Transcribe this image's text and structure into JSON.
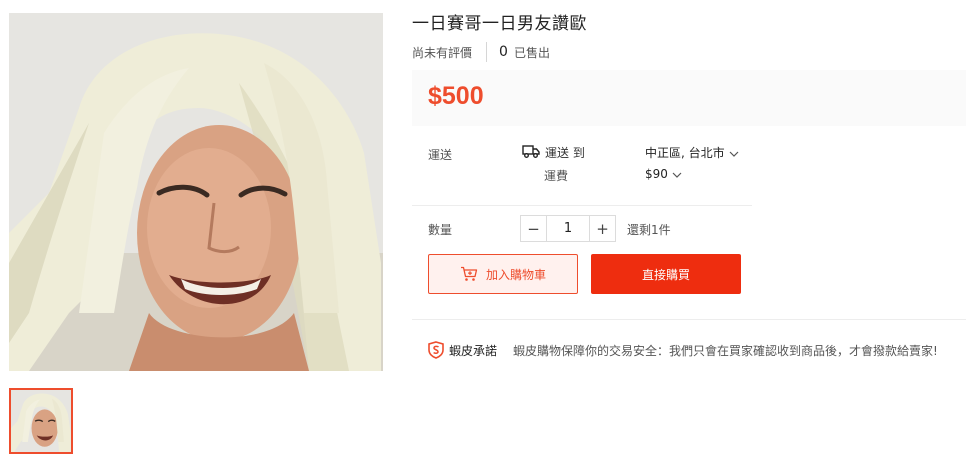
{
  "product": {
    "title": "一日賽哥一日男友讚歐",
    "rating_text": "尚未有評價",
    "sold_count": "0",
    "sold_label": "已售出",
    "price": "$500"
  },
  "shipping": {
    "label": "運送",
    "ship_to": "運送 到",
    "fee_label": "運費",
    "destination": "中正區, 台北市",
    "fee": "$90"
  },
  "quantity": {
    "label": "數量",
    "minus": "−",
    "value": "1",
    "plus": "+",
    "stock": "還剩1件"
  },
  "actions": {
    "add_to_cart": "加入購物車",
    "buy_now": "直接購買"
  },
  "guarantee": {
    "label": "蝦皮承諾",
    "text": "蝦皮購物保障你的交易安全：我們只會在買家確認收到商品後，才會撥款給賣家!"
  },
  "icons": {
    "truck": "truck-icon",
    "chevron": "chevron-down-icon",
    "cart": "cart-icon",
    "shield": "shield-icon"
  },
  "colors": {
    "accent": "#ee4d2d",
    "buy_now_bg": "#ee2d0f",
    "add_cart_bg": "#fff1ee",
    "price_box_bg": "#fafafa"
  }
}
